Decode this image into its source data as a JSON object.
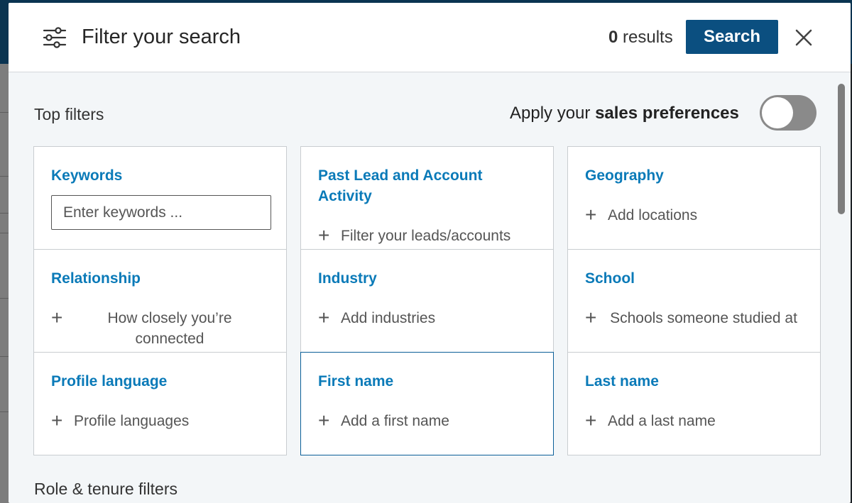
{
  "header": {
    "title": "Filter your search",
    "results_count": "0",
    "results_label": "results",
    "search_label": "Search"
  },
  "top_filters": {
    "title": "Top filters",
    "prefs_prefix": "Apply your",
    "prefs_bold": "sales preferences",
    "prefs_enabled": false
  },
  "cards": {
    "keywords": {
      "title": "Keywords",
      "placeholder": "Enter keywords ..."
    },
    "past_activity": {
      "title": "Past Lead and Account Activity",
      "action": "Filter your leads/accounts"
    },
    "geography": {
      "title": "Geography",
      "action": "Add locations"
    },
    "relationship": {
      "title": "Relationship",
      "action": "How closely you’re connected"
    },
    "industry": {
      "title": "Industry",
      "action": "Add industries"
    },
    "school": {
      "title": "School",
      "action": "Schools someone studied at"
    },
    "profile_language": {
      "title": "Profile language",
      "action": "Profile languages"
    },
    "first_name": {
      "title": "First name",
      "action": "Add a first name"
    },
    "last_name": {
      "title": "Last name",
      "action": "Add a last name"
    }
  },
  "role_filters": {
    "title": "Role & tenure filters"
  },
  "colors": {
    "accent": "#0a7ab8",
    "button": "#0b4f80",
    "toggle_off": "#8a8a8a"
  }
}
